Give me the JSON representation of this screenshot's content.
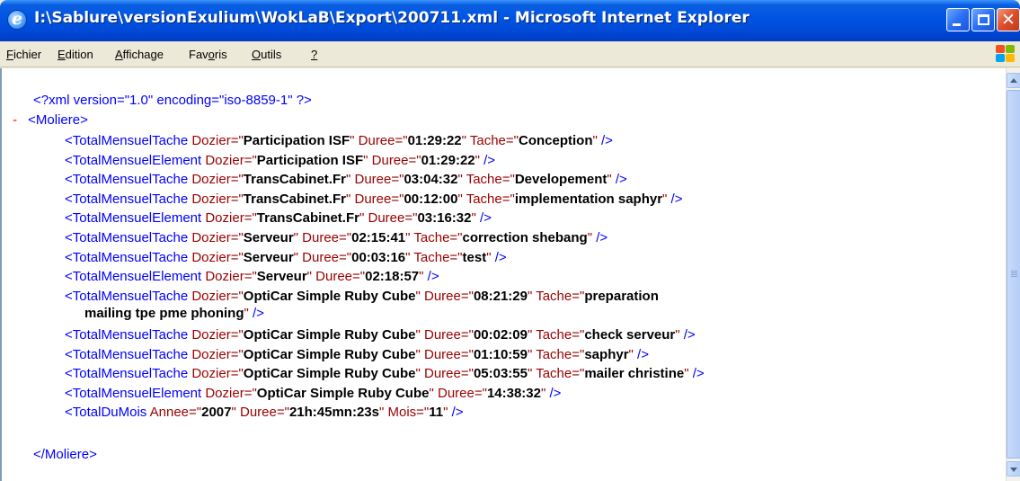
{
  "window": {
    "title": "I:\\Sablure\\versionExulium\\WokLaB\\Export\\200711.xml - Microsoft Internet Explorer"
  },
  "menu": {
    "items": [
      "Fichier",
      "Edition",
      "Affichage",
      "Favoris",
      "Outils",
      "?"
    ]
  },
  "xml": {
    "declaration": "<?xml version=\"1.0\" encoding=\"iso-8859-1\" ?>",
    "collapse_marker": "-",
    "root_open": "<Moliere>",
    "root_close": "</Moliere>",
    "lines": [
      {
        "tag": "TotalMensuelTache",
        "attrs": [
          [
            "Dozier",
            "Participation ISF"
          ],
          [
            "Duree",
            "01:29:22"
          ],
          [
            "Tache",
            "Conception"
          ]
        ]
      },
      {
        "tag": "TotalMensuelElement",
        "attrs": [
          [
            "Dozier",
            "Participation ISF"
          ],
          [
            "Duree",
            "01:29:22"
          ]
        ]
      },
      {
        "tag": "TotalMensuelTache",
        "attrs": [
          [
            "Dozier",
            "TransCabinet.Fr"
          ],
          [
            "Duree",
            "03:04:32"
          ],
          [
            "Tache",
            "Developement"
          ]
        ]
      },
      {
        "tag": "TotalMensuelTache",
        "attrs": [
          [
            "Dozier",
            "TransCabinet.Fr"
          ],
          [
            "Duree",
            "00:12:00"
          ],
          [
            "Tache",
            "implementation saphyr"
          ]
        ]
      },
      {
        "tag": "TotalMensuelElement",
        "attrs": [
          [
            "Dozier",
            "TransCabinet.Fr"
          ],
          [
            "Duree",
            "03:16:32"
          ]
        ]
      },
      {
        "tag": "TotalMensuelTache",
        "attrs": [
          [
            "Dozier",
            "Serveur"
          ],
          [
            "Duree",
            "02:15:41"
          ],
          [
            "Tache",
            "correction shebang"
          ]
        ]
      },
      {
        "tag": "TotalMensuelTache",
        "attrs": [
          [
            "Dozier",
            "Serveur"
          ],
          [
            "Duree",
            "00:03:16"
          ],
          [
            "Tache",
            "test"
          ]
        ]
      },
      {
        "tag": "TotalMensuelElement",
        "attrs": [
          [
            "Dozier",
            "Serveur"
          ],
          [
            "Duree",
            "02:18:57"
          ]
        ]
      },
      {
        "tag": "TotalMensuelTache",
        "attrs": [
          [
            "Dozier",
            "OptiCar Simple Ruby Cube"
          ],
          [
            "Duree",
            "08:21:29"
          ],
          [
            "Tache",
            "preparation mailing tpe pme phoning"
          ]
        ]
      },
      {
        "tag": "TotalMensuelTache",
        "attrs": [
          [
            "Dozier",
            "OptiCar Simple Ruby Cube"
          ],
          [
            "Duree",
            "00:02:09"
          ],
          [
            "Tache",
            "check serveur"
          ]
        ]
      },
      {
        "tag": "TotalMensuelTache",
        "attrs": [
          [
            "Dozier",
            "OptiCar Simple Ruby Cube"
          ],
          [
            "Duree",
            "01:10:59"
          ],
          [
            "Tache",
            "saphyr"
          ]
        ]
      },
      {
        "tag": "TotalMensuelTache",
        "attrs": [
          [
            "Dozier",
            "OptiCar Simple Ruby Cube"
          ],
          [
            "Duree",
            "05:03:55"
          ],
          [
            "Tache",
            "mailer christine"
          ]
        ]
      },
      {
        "tag": "TotalMensuelElement",
        "attrs": [
          [
            "Dozier",
            "OptiCar Simple Ruby Cube"
          ],
          [
            "Duree",
            "14:38:32"
          ]
        ]
      },
      {
        "tag": "TotalDuMois",
        "attrs": [
          [
            "Annee",
            "2007"
          ],
          [
            "Duree",
            "21h:45mn:23s"
          ],
          [
            "Mois",
            "11"
          ]
        ]
      }
    ]
  },
  "colors": {
    "tag": "#0000ff",
    "attr_name": "#990000",
    "attr_value": "#000000",
    "collapse_marker": "#ff0000"
  },
  "icons": {
    "app": "internet-explorer-icon",
    "logo": "windows-flag-icon"
  }
}
